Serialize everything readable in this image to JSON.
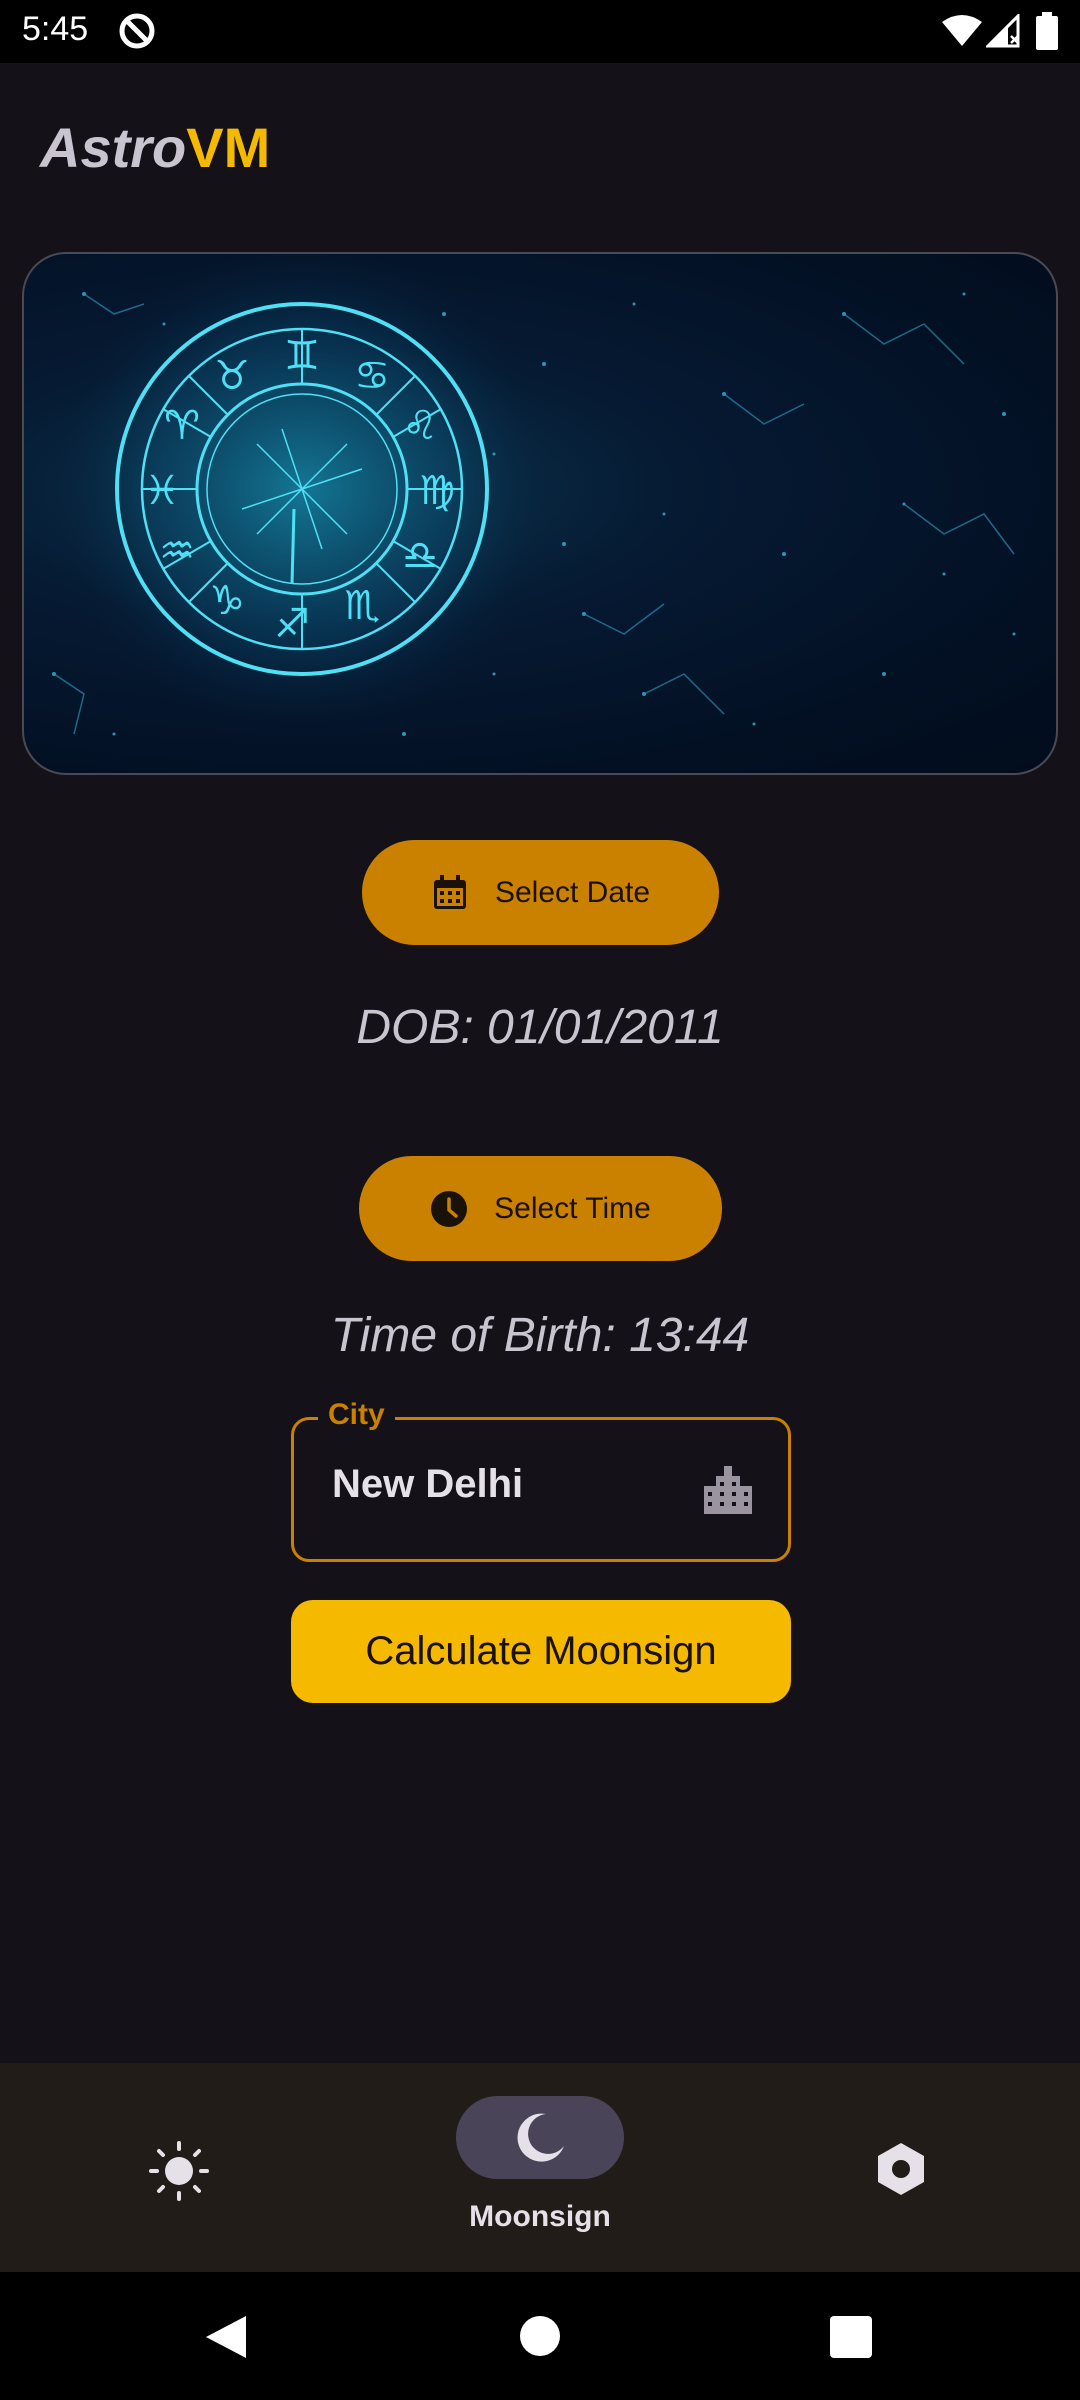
{
  "status_bar": {
    "time": "5:45",
    "icons": [
      "data-saver-icon",
      "wifi-icon",
      "signal-icon",
      "battery-icon"
    ]
  },
  "app": {
    "title_part1": "Astro",
    "title_part2": "VM",
    "accent_color": "#f5b900",
    "button_color": "#ca8100",
    "background_color": "#141218"
  },
  "banner": {
    "image": "zodiac-wheel-constellations"
  },
  "date_section": {
    "button_label": "Select Date",
    "button_icon": "calendar-icon",
    "value_text": "DOB: 01/01/2011"
  },
  "time_section": {
    "button_label": "Select Time",
    "button_icon": "clock-icon",
    "value_text": "Time of Birth: 13:44"
  },
  "city_field": {
    "label": "City",
    "value": "New Delhi",
    "icon": "city-buildings-icon"
  },
  "calculate_button": {
    "label": "Calculate Moonsign"
  },
  "bottom_nav": {
    "items": [
      {
        "icon": "sun-icon",
        "label": "",
        "selected": false
      },
      {
        "icon": "moon-icon",
        "label": "Moonsign",
        "selected": true
      },
      {
        "icon": "settings-icon",
        "label": "",
        "selected": false
      }
    ]
  },
  "system_nav": {
    "buttons": [
      "back",
      "home",
      "recents"
    ]
  }
}
